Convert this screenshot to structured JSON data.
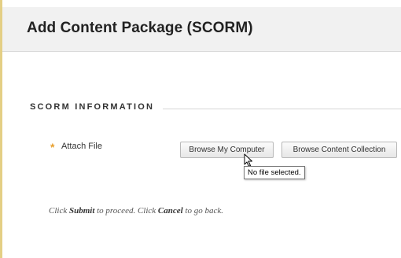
{
  "header": {
    "title": "Add Content Package (SCORM)"
  },
  "section": {
    "title": "SCORM INFORMATION"
  },
  "attach": {
    "required_marker": "*",
    "label": "Attach File",
    "browse_computer_label": "Browse My Computer",
    "browse_collection_label": "Browse Content Collection",
    "tooltip": "No file selected."
  },
  "instructions": {
    "part1": "Click ",
    "submit": "Submit",
    "part2": " to proceed. Click ",
    "cancel": "Cancel",
    "part3": " to go back."
  },
  "colors": {
    "accent": "#e4cf85",
    "required": "#e8a02f",
    "header_bg": "#f1f1f1"
  },
  "icons": {
    "cursor": "mouse-pointer-icon"
  }
}
